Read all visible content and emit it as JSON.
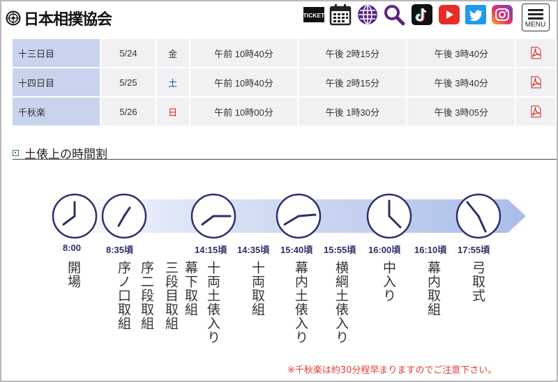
{
  "header": {
    "logo_text": "日本相撲協会",
    "icons": [
      "ticket-icon",
      "calendar-icon",
      "globe-icon",
      "search-icon",
      "tiktok-icon",
      "youtube-icon",
      "twitter-icon",
      "instagram-icon"
    ],
    "ticket_label": "TICKET",
    "menu_label": "MENU"
  },
  "schedule_rows": [
    {
      "day": "十三日目",
      "date": "5/24",
      "weekday": "金",
      "weekday_color": "#333333",
      "t1": "午前 10時40分",
      "t2": "午後 2時15分",
      "t3": "午後 3時40分"
    },
    {
      "day": "十四日目",
      "date": "5/25",
      "weekday": "土",
      "weekday_color": "#2849a8",
      "t1": "午前 10時40分",
      "t2": "午後 2時15分",
      "t3": "午後 3時40分"
    },
    {
      "day": "千秋楽",
      "date": "5/26",
      "weekday": "日",
      "weekday_color": "#dd2222",
      "t1": "午前 10時00分",
      "t2": "午後 1時30分",
      "t3": "午後 3時05分"
    }
  ],
  "section_title": "土俵上の時間割",
  "timeline": {
    "times": [
      "8:00",
      "8:35頃",
      "14:15頃",
      "14:35頃",
      "15:40頃",
      "15:55頃",
      "16:00頃",
      "16:10頃",
      "17:55頃"
    ],
    "labels": [
      "開場",
      "序ノ口取組",
      "序二段取組",
      "三段目取組",
      "幕下取組",
      "十両土俵入り",
      "十両取組",
      "幕内土俵入り",
      "横綱土俵入り",
      "中入り",
      "幕内取組",
      "弓取式"
    ],
    "note": "※千秋楽は約30分程早まりますのでご注意下さい。"
  },
  "colors": {
    "accent": "#2c2e6a",
    "day_bg": "#c9d3ee",
    "note": "#e23b3b"
  }
}
